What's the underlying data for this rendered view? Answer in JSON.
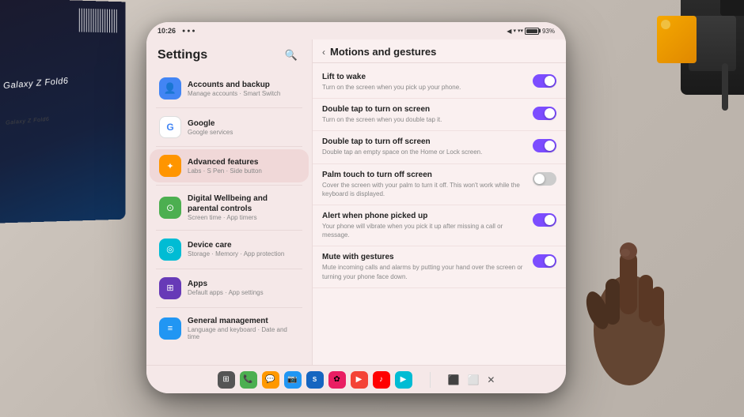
{
  "background": {
    "color": "#c8c0b8"
  },
  "phone": {
    "status_bar": {
      "time": "10:26",
      "battery": "93%",
      "signal_icons": "◀ ▾ ▾ ▾"
    },
    "settings_panel": {
      "title": "Settings",
      "search_icon": "🔍",
      "items": [
        {
          "id": "accounts",
          "title": "Accounts and backup",
          "subtitle": "Manage accounts · Smart Switch",
          "icon": "👤",
          "icon_color": "#4285f4",
          "active": false
        },
        {
          "id": "google",
          "title": "Google",
          "subtitle": "Google services",
          "icon": "G",
          "icon_color": "#ffffff",
          "active": false
        },
        {
          "id": "advanced",
          "title": "Advanced features",
          "subtitle": "Labs · S Pen · Side button",
          "icon": "✦",
          "icon_color": "#ff9500",
          "active": false
        },
        {
          "id": "digital-wellbeing",
          "title": "Digital Wellbeing and parental controls",
          "subtitle": "Screen time · App timers",
          "icon": "⊙",
          "icon_color": "#4caf50",
          "active": false
        },
        {
          "id": "device-care",
          "title": "Device care",
          "subtitle": "Storage · Memory · App protection",
          "icon": "◎",
          "icon_color": "#00bcd4",
          "active": false
        },
        {
          "id": "apps",
          "title": "Apps",
          "subtitle": "Default apps · App settings",
          "icon": "⊞",
          "icon_color": "#673ab7",
          "active": false
        },
        {
          "id": "general",
          "title": "General management",
          "subtitle": "Language and keyboard · Date and time",
          "icon": "≡",
          "icon_color": "#2196f3",
          "active": false
        }
      ]
    },
    "gestures_panel": {
      "title": "Motions and gestures",
      "back_label": "‹",
      "items": [
        {
          "id": "lift-to-wake",
          "title": "Lift to wake",
          "desc": "Turn on the screen when you pick up your phone.",
          "toggle": true
        },
        {
          "id": "double-tap-on",
          "title": "Double tap to turn on screen",
          "desc": "Turn on the screen when you double tap it.",
          "toggle": true
        },
        {
          "id": "double-tap-off",
          "title": "Double tap to turn off screen",
          "desc": "Double tap an empty space on the Home or Lock screen.",
          "toggle": true
        },
        {
          "id": "palm-touch",
          "title": "Palm touch to turn off screen",
          "desc": "Cover the screen with your palm to turn it off. This won't work while the keyboard is displayed.",
          "toggle": false
        },
        {
          "id": "alert-pickup",
          "title": "Alert when phone picked up",
          "desc": "Your phone will vibrate when you pick it up after missing a call or message.",
          "toggle": true
        },
        {
          "id": "mute-gestures",
          "title": "Mute with gestures",
          "desc": "Mute incoming calls and alarms by putting your hand over the screen or turning your phone face down.",
          "toggle": true
        }
      ]
    },
    "bottom_nav": {
      "apps": [
        {
          "id": "phone",
          "icon": "📞",
          "color": "#4caf50"
        },
        {
          "id": "contacts",
          "icon": "👥",
          "color": "#ff9800"
        },
        {
          "id": "messages",
          "icon": "💬",
          "color": "#2196f3"
        },
        {
          "id": "samsung",
          "icon": "S",
          "color": "#1565c0"
        },
        {
          "id": "flowers",
          "icon": "✿",
          "color": "#e91e63"
        },
        {
          "id": "youtube",
          "icon": "▶",
          "color": "#f44336"
        },
        {
          "id": "youtube-music",
          "icon": "♪",
          "color": "#ff0000"
        },
        {
          "id": "play",
          "icon": "▶",
          "color": "#00bcd4"
        }
      ],
      "gesture_btns": [
        "⬛",
        "⬜",
        "✕"
      ]
    }
  }
}
